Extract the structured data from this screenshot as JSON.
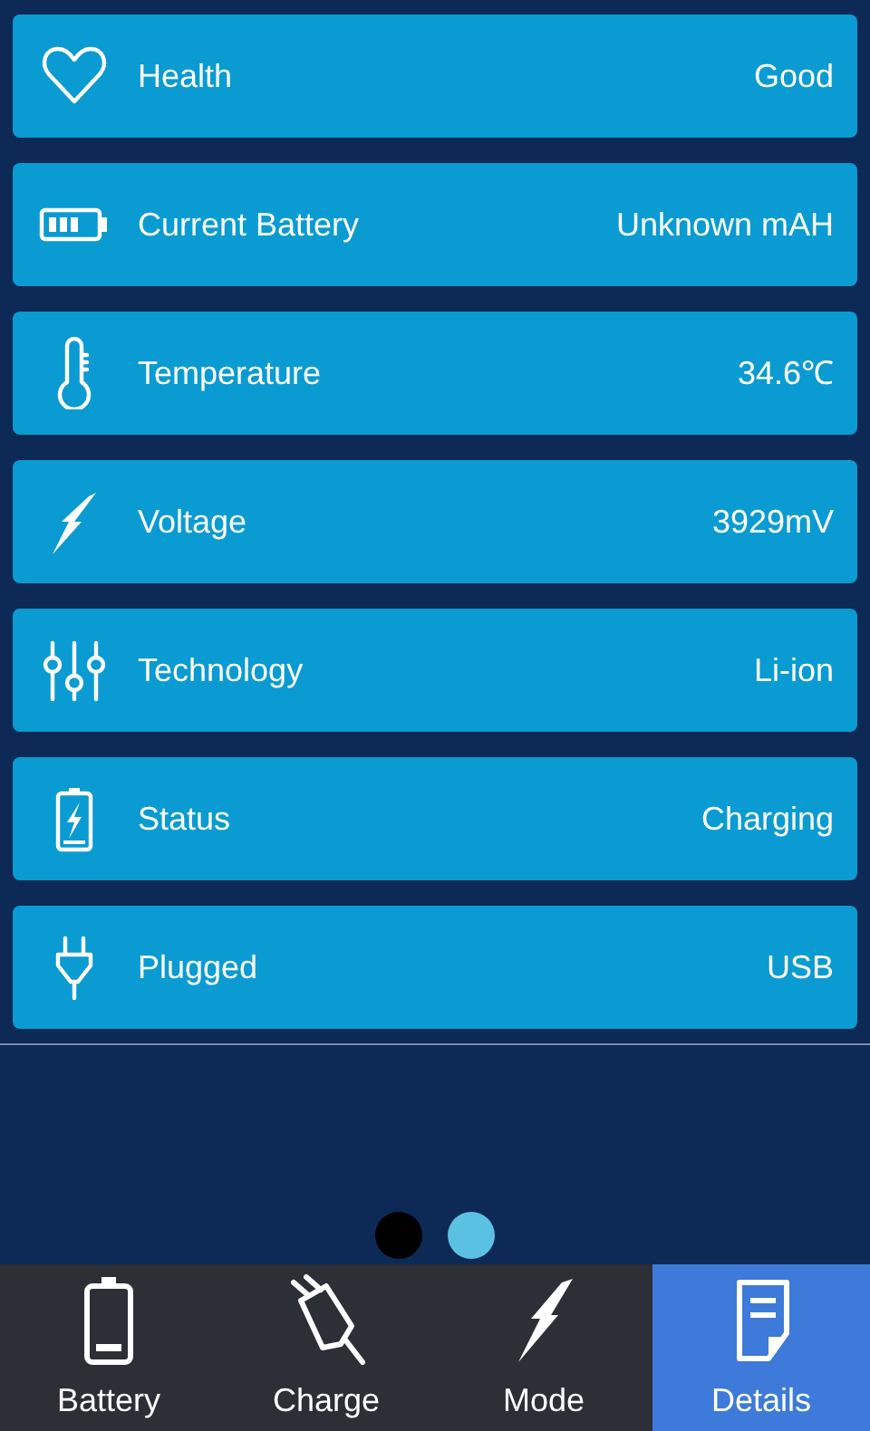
{
  "details": [
    {
      "kind": "health",
      "label": "Health",
      "value": "Good"
    },
    {
      "kind": "battery",
      "label": "Current Battery",
      "value": "Unknown mAH"
    },
    {
      "kind": "temperature",
      "label": "Temperature",
      "value": "34.6℃"
    },
    {
      "kind": "voltage",
      "label": "Voltage",
      "value": "3929mV"
    },
    {
      "kind": "technology",
      "label": "Technology",
      "value": "Li-ion"
    },
    {
      "kind": "status",
      "label": "Status",
      "value": "Charging"
    },
    {
      "kind": "plugged",
      "label": "Plugged",
      "value": "USB"
    }
  ],
  "pages": [
    {
      "selected": false
    },
    {
      "selected": true
    }
  ],
  "tabs": [
    {
      "kind": "battery",
      "label": "Battery",
      "selected": false
    },
    {
      "kind": "charge",
      "label": "Charge",
      "selected": false
    },
    {
      "kind": "mode",
      "label": "Mode",
      "selected": false
    },
    {
      "kind": "details",
      "label": "Details",
      "selected": true
    }
  ]
}
